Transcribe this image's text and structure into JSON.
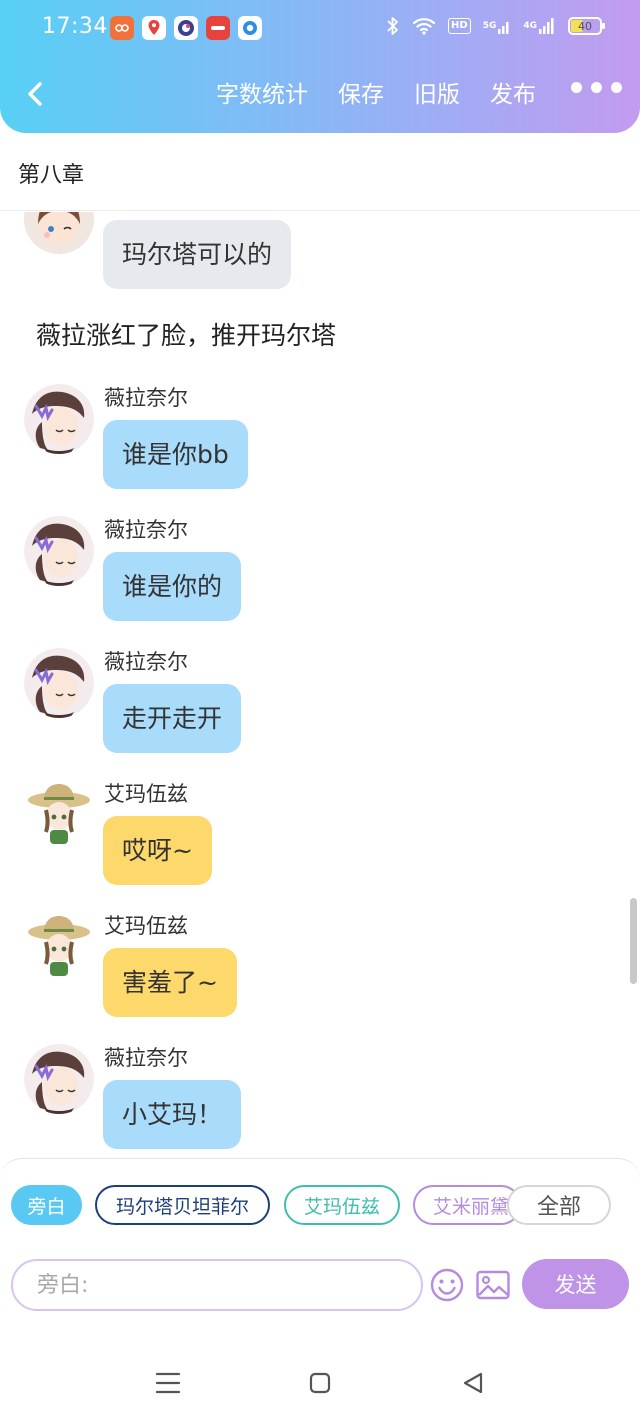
{
  "status_bar": {
    "time": "17:34",
    "hd_badge": "HD",
    "net_5g": "5G",
    "net_4g": "4G",
    "battery_level": "40"
  },
  "toolbar": {
    "word_count": "字数统计",
    "save": "保存",
    "old_version": "旧版",
    "publish": "发布"
  },
  "chapter": {
    "title": "第八章"
  },
  "chat": {
    "m0": {
      "text": "玛尔塔可以的"
    },
    "narration": "薇拉涨红了脸，推开玛尔塔",
    "m1": {
      "sender": "薇拉奈尔",
      "text": "谁是你bb"
    },
    "m2": {
      "sender": "薇拉奈尔",
      "text": "谁是你的"
    },
    "m3": {
      "sender": "薇拉奈尔",
      "text": "走开走开"
    },
    "m4": {
      "sender": "艾玛伍兹",
      "text": "哎呀~"
    },
    "m5": {
      "sender": "艾玛伍兹",
      "text": "害羞了~"
    },
    "m6": {
      "sender": "薇拉奈尔",
      "text": "小艾玛！"
    }
  },
  "characters": {
    "narrator": "旁白",
    "c1": "玛尔塔贝坦菲尔",
    "c2": "艾玛伍兹",
    "c3": "艾米丽黛",
    "all": "全部"
  },
  "composer": {
    "placeholder": "旁白:",
    "send": "发送"
  },
  "colors": {
    "header_start": "#57d0f5",
    "header_end": "#c39bf0",
    "bubble_vera": "#a9dbfb",
    "bubble_emma": "#fdd86a",
    "bubble_martha": "#e6e9ee",
    "send_button": "#be93e8"
  }
}
